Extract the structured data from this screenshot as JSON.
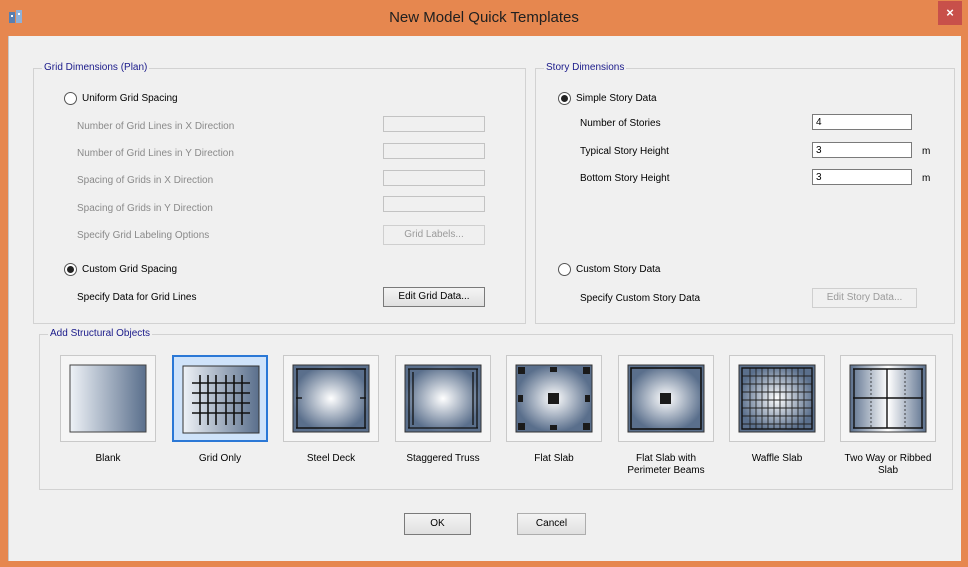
{
  "window": {
    "title": "New Model Quick Templates",
    "close_label": "×"
  },
  "grid": {
    "group_title": "Grid Dimensions (Plan)",
    "uniform_label": "Uniform Grid Spacing",
    "uniform_selected": false,
    "fields": [
      {
        "label": "Number of Grid Lines in X Direction",
        "value": ""
      },
      {
        "label": "Number of Grid Lines in Y Direction",
        "value": ""
      },
      {
        "label": "Spacing of Grids in X Direction",
        "value": ""
      },
      {
        "label": "Spacing of Grids in Y Direction",
        "value": ""
      }
    ],
    "labeling_label": "Specify Grid Labeling Options",
    "grid_labels_button": "Grid Labels...",
    "custom_label": "Custom Grid Spacing",
    "custom_selected": true,
    "specify_data_label": "Specify Data for Grid Lines",
    "edit_grid_button": "Edit Grid Data..."
  },
  "story": {
    "group_title": "Story Dimensions",
    "simple_label": "Simple Story Data",
    "simple_selected": true,
    "fields": [
      {
        "label": "Number of Stories",
        "value": "4",
        "unit": ""
      },
      {
        "label": "Typical Story Height",
        "value": "3",
        "unit": "m"
      },
      {
        "label": "Bottom Story Height",
        "value": "3",
        "unit": "m"
      }
    ],
    "custom_label": "Custom Story Data",
    "custom_selected": false,
    "specify_custom_label": "Specify Custom Story Data",
    "edit_story_button": "Edit Story Data..."
  },
  "objects": {
    "group_title": "Add Structural Objects",
    "selected": "Grid Only",
    "tiles": [
      {
        "label": "Blank",
        "icon": "blank-template-icon"
      },
      {
        "label": "Grid Only",
        "icon": "grid-only-template-icon"
      },
      {
        "label": "Steel Deck",
        "icon": "steel-deck-template-icon"
      },
      {
        "label": "Staggered Truss",
        "icon": "staggered-truss-template-icon"
      },
      {
        "label": "Flat Slab",
        "icon": "flat-slab-template-icon"
      },
      {
        "label": "Flat Slab with Perimeter Beams",
        "icon": "flat-slab-perimeter-beams-template-icon"
      },
      {
        "label": "Waffle Slab",
        "icon": "waffle-slab-template-icon"
      },
      {
        "label": "Two Way or Ribbed Slab",
        "icon": "two-way-ribbed-slab-template-icon"
      }
    ]
  },
  "buttons": {
    "ok": "OK",
    "cancel": "Cancel"
  },
  "colors": {
    "title_bar": "#e6874f",
    "selection": "#2b78d6",
    "group_title": "#1a1a8a"
  }
}
